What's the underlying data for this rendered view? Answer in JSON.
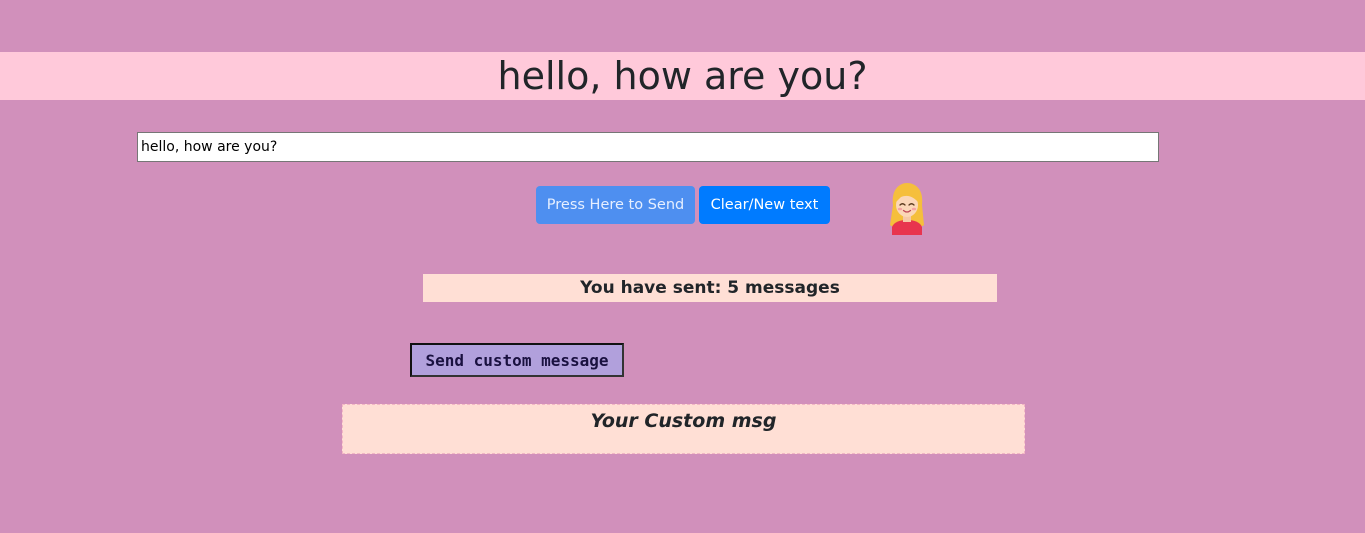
{
  "heading": "hello, how are you?",
  "message_input": {
    "value": "hello, how are you?"
  },
  "buttons": {
    "send_label": "Press Here to Send",
    "clear_label": "Clear/New text",
    "custom_label": "Send custom message"
  },
  "avatar": {
    "icon": "smiling-girl-emoji-icon"
  },
  "counter_text": "You have sent: 5 messages",
  "custom_msg_text": "Your Custom msg",
  "colors": {
    "page_background": "#d190bb",
    "banner_background": "#ffc9da",
    "send_button": "#4e8ff0",
    "clear_button": "#007bff",
    "counter_background": "#ffdfd5",
    "custom_button": "#b1a0dc"
  }
}
